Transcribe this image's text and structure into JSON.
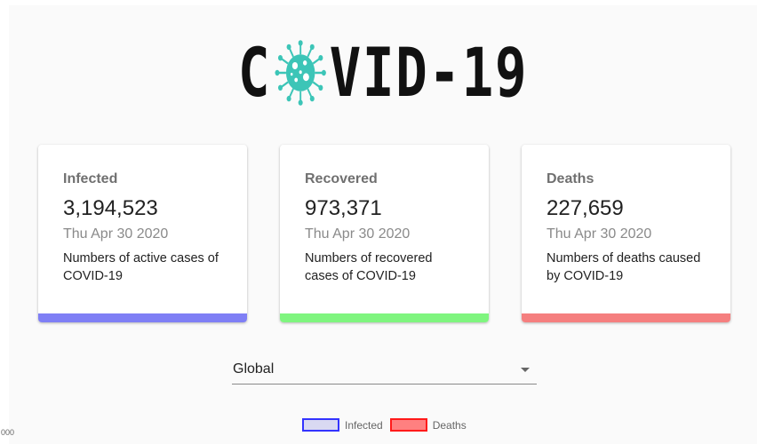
{
  "logo": {
    "text_before": "C",
    "text_after": "VID-19",
    "virus_icon": "virus-icon",
    "virus_color": "#3cc5b7"
  },
  "cards": [
    {
      "title": "Infected",
      "value": "3,194,523",
      "date": "Thu Apr 30 2020",
      "description": "Numbers of active cases of COVID-19",
      "color": "#7f7ff5"
    },
    {
      "title": "Recovered",
      "value": "973,371",
      "date": "Thu Apr 30 2020",
      "description": "Numbers of recovered cases of COVID-19",
      "color": "#7ff57f"
    },
    {
      "title": "Deaths",
      "value": "227,659",
      "date": "Thu Apr 30 2020",
      "description": "Numbers of deaths caused by COVID-19",
      "color": "#f57f7f"
    }
  ],
  "country_select": {
    "value": "Global"
  },
  "chart": {
    "legend": [
      {
        "label": "Infected",
        "border_color": "#3333ff",
        "fill_color": "#d9d9f2"
      },
      {
        "label": "Deaths",
        "border_color": "#ff1a1a",
        "fill_color": "#ff8080"
      }
    ],
    "y_tick_top": "000"
  }
}
